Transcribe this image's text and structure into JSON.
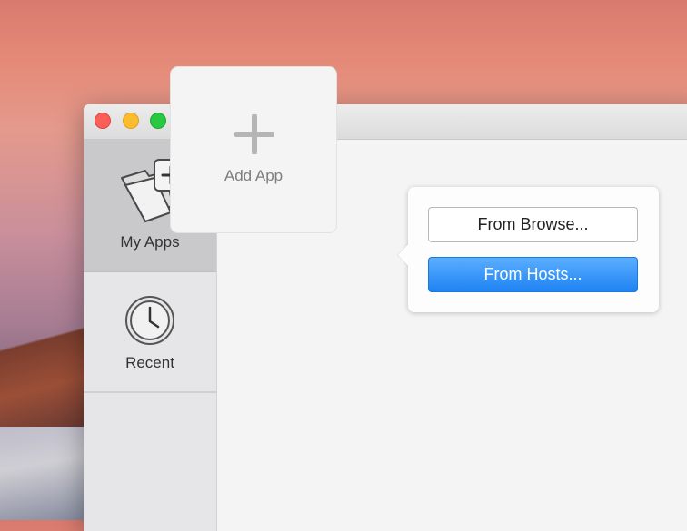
{
  "window": {
    "traffic_lights": {
      "close_color": "#fc5f57",
      "minimize_color": "#fdbc2e",
      "maximize_color": "#28c840"
    }
  },
  "sidebar": {
    "items": [
      {
        "label": "My Apps",
        "icon": "folder-plus-icon",
        "active": true
      },
      {
        "label": "Recent",
        "icon": "clock-icon",
        "active": false
      }
    ]
  },
  "content": {
    "add_card": {
      "label": "Add App",
      "icon": "plus-icon"
    }
  },
  "popover": {
    "buttons": [
      {
        "label": "From Browse...",
        "style": "default"
      },
      {
        "label": "From Hosts...",
        "style": "primary",
        "color": "#1f83f2"
      }
    ]
  }
}
